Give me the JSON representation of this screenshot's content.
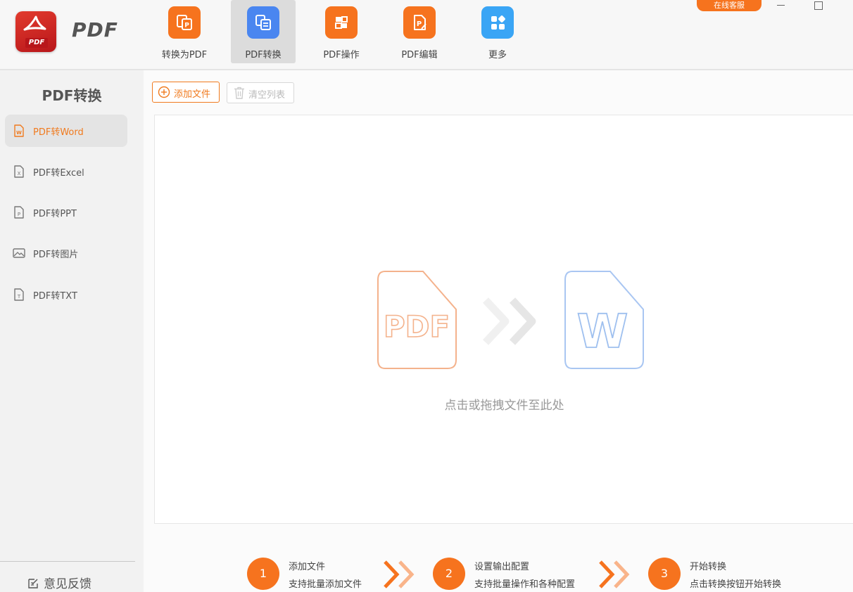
{
  "app": {
    "title": "PDF",
    "logo_text": "PDF"
  },
  "nav": [
    {
      "label": "转换为PDF",
      "icon": "convert-to-pdf-icon",
      "color": "#f6731e"
    },
    {
      "label": "PDF转换",
      "icon": "pdf-convert-icon",
      "color": "#4a86f0",
      "active": true
    },
    {
      "label": "PDF操作",
      "icon": "pdf-operate-icon",
      "color": "#f6731e"
    },
    {
      "label": "PDF编辑",
      "icon": "pdf-edit-icon",
      "color": "#f6731e"
    },
    {
      "label": "更多",
      "icon": "more-grid-icon",
      "color": "#3aa5f5"
    }
  ],
  "window": {
    "support_label": "在线客服"
  },
  "sidebar": {
    "title": "PDF转换",
    "items": [
      {
        "label": "PDF转Word",
        "icon": "word-file-icon",
        "active": true
      },
      {
        "label": "PDF转Excel",
        "icon": "excel-file-icon"
      },
      {
        "label": "PDF转PPT",
        "icon": "ppt-file-icon"
      },
      {
        "label": "PDF转图片",
        "icon": "image-icon"
      },
      {
        "label": "PDF转TXT",
        "icon": "txt-file-icon"
      }
    ],
    "feedback_label": "意见反馈"
  },
  "toolbar": {
    "add_label": "添加文件",
    "clear_label": "清空列表"
  },
  "dropzone": {
    "hint": "点击或拖拽文件至此处",
    "source_label": "PDF",
    "target_label": "W"
  },
  "steps": [
    {
      "number": "1",
      "title": "添加文件",
      "desc": "支持批量添加文件"
    },
    {
      "number": "2",
      "title": "设置输出配置",
      "desc": "支持批量操作和各种配置"
    },
    {
      "number": "3",
      "title": "开始转换",
      "desc": "点击转换按钮开始转换"
    }
  ],
  "colors": {
    "accent": "#f6731e",
    "active_text": "#f07a1e",
    "blue": "#4a86f0"
  }
}
